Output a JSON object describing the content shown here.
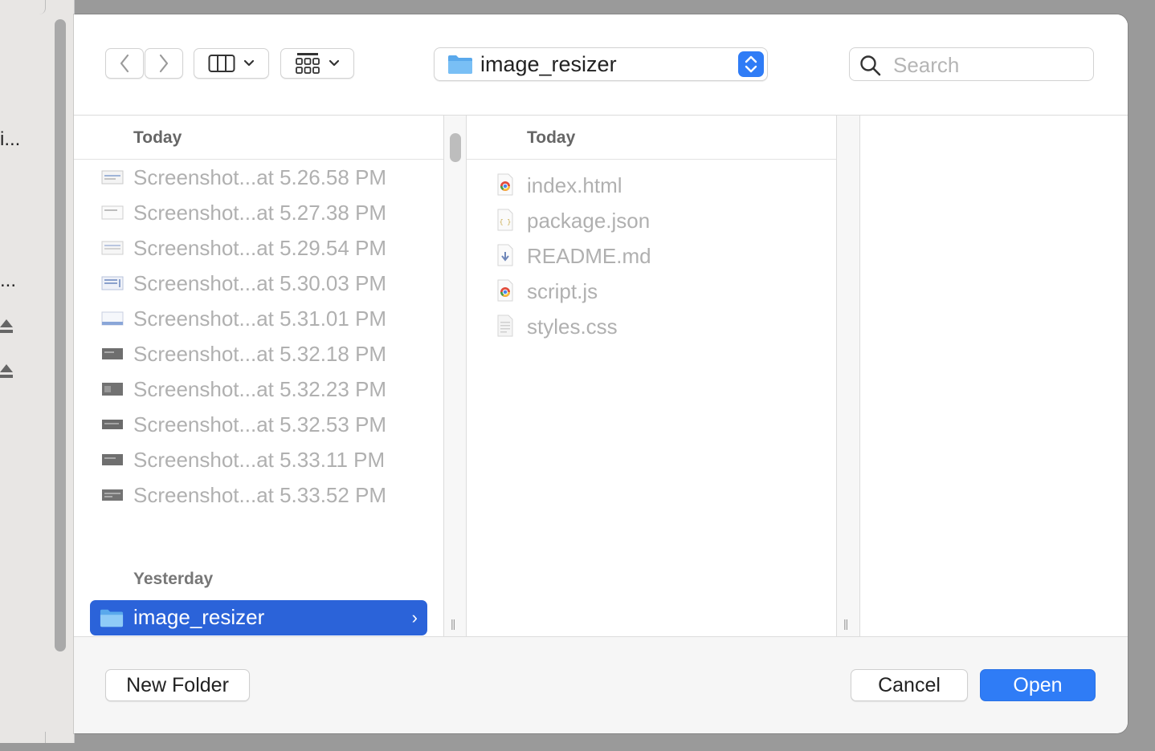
{
  "background_window": {
    "fragments": [
      "i...",
      "..."
    ]
  },
  "toolbar": {
    "current_folder": "image_resizer",
    "search_placeholder": "Search"
  },
  "column1": {
    "header": "Today",
    "items": [
      "Screenshot...at 5.26.58 PM",
      "Screenshot...at 5.27.38 PM",
      "Screenshot...at 5.29.54 PM",
      "Screenshot...at 5.30.03 PM",
      "Screenshot...at 5.31.01 PM",
      "Screenshot...at 5.32.18 PM",
      "Screenshot...at 5.32.23 PM",
      "Screenshot...at 5.32.53 PM",
      "Screenshot...at 5.33.11 PM",
      "Screenshot...at 5.33.52 PM"
    ],
    "section_yesterday": "Yesterday",
    "selected_folder": "image_resizer"
  },
  "column2": {
    "header": "Today",
    "items": [
      {
        "name": "index.html",
        "icon": "chrome-html-icon"
      },
      {
        "name": "package.json",
        "icon": "json-file-icon"
      },
      {
        "name": "README.md",
        "icon": "markdown-file-icon"
      },
      {
        "name": "script.js",
        "icon": "chrome-js-icon"
      },
      {
        "name": "styles.css",
        "icon": "css-file-icon"
      }
    ]
  },
  "buttons": {
    "new_folder": "New Folder",
    "cancel": "Cancel",
    "open": "Open"
  },
  "colors": {
    "accent": "#2f7cf6",
    "selection": "#2b63d9"
  }
}
